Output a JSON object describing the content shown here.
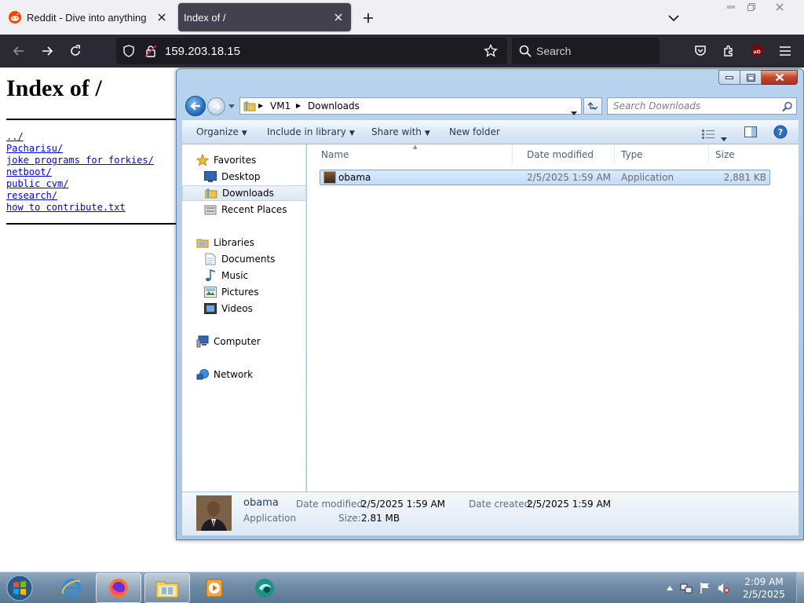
{
  "browser": {
    "tabs": [
      {
        "title": "Reddit - Dive into anything",
        "favicon": "reddit-icon",
        "active": false
      },
      {
        "title": "Index of /",
        "favicon": "",
        "active": true
      }
    ],
    "url": "159.203.18.15",
    "search_placeholder": "Search",
    "accent_color": "#42414d"
  },
  "page": {
    "heading": "Index of /",
    "links": [
      "../",
      "Pacharisu/",
      "joke programs for forkies/",
      "netboot/",
      "public cvm/",
      "research/",
      "how to contribute.txt"
    ]
  },
  "explorer": {
    "breadcrumb": [
      "VM1",
      "Downloads"
    ],
    "search_placeholder": "Search Downloads",
    "commands": [
      "Organize",
      "Include in library",
      "Share with",
      "New folder"
    ],
    "nav": {
      "favorites": {
        "label": "Favorites",
        "items": [
          "Desktop",
          "Downloads",
          "Recent Places"
        ]
      },
      "libraries": {
        "label": "Libraries",
        "items": [
          "Documents",
          "Music",
          "Pictures",
          "Videos"
        ]
      },
      "computer": "Computer",
      "network": "Network"
    },
    "columns": [
      "Name",
      "Date modified",
      "Type",
      "Size"
    ],
    "files": [
      {
        "name": "obama",
        "date_modified": "2/5/2025 1:59 AM",
        "type": "Application",
        "size": "2,881 KB"
      }
    ],
    "details": {
      "name": "obama",
      "type": "Application",
      "date_modified_label": "Date modified:",
      "date_modified": "2/5/2025 1:59 AM",
      "size_label": "Size:",
      "size": "2.81 MB",
      "date_created_label": "Date created:",
      "date_created": "2/5/2025 1:59 AM"
    }
  },
  "taskbar": {
    "time": "2:09 AM",
    "date": "2/5/2025"
  }
}
